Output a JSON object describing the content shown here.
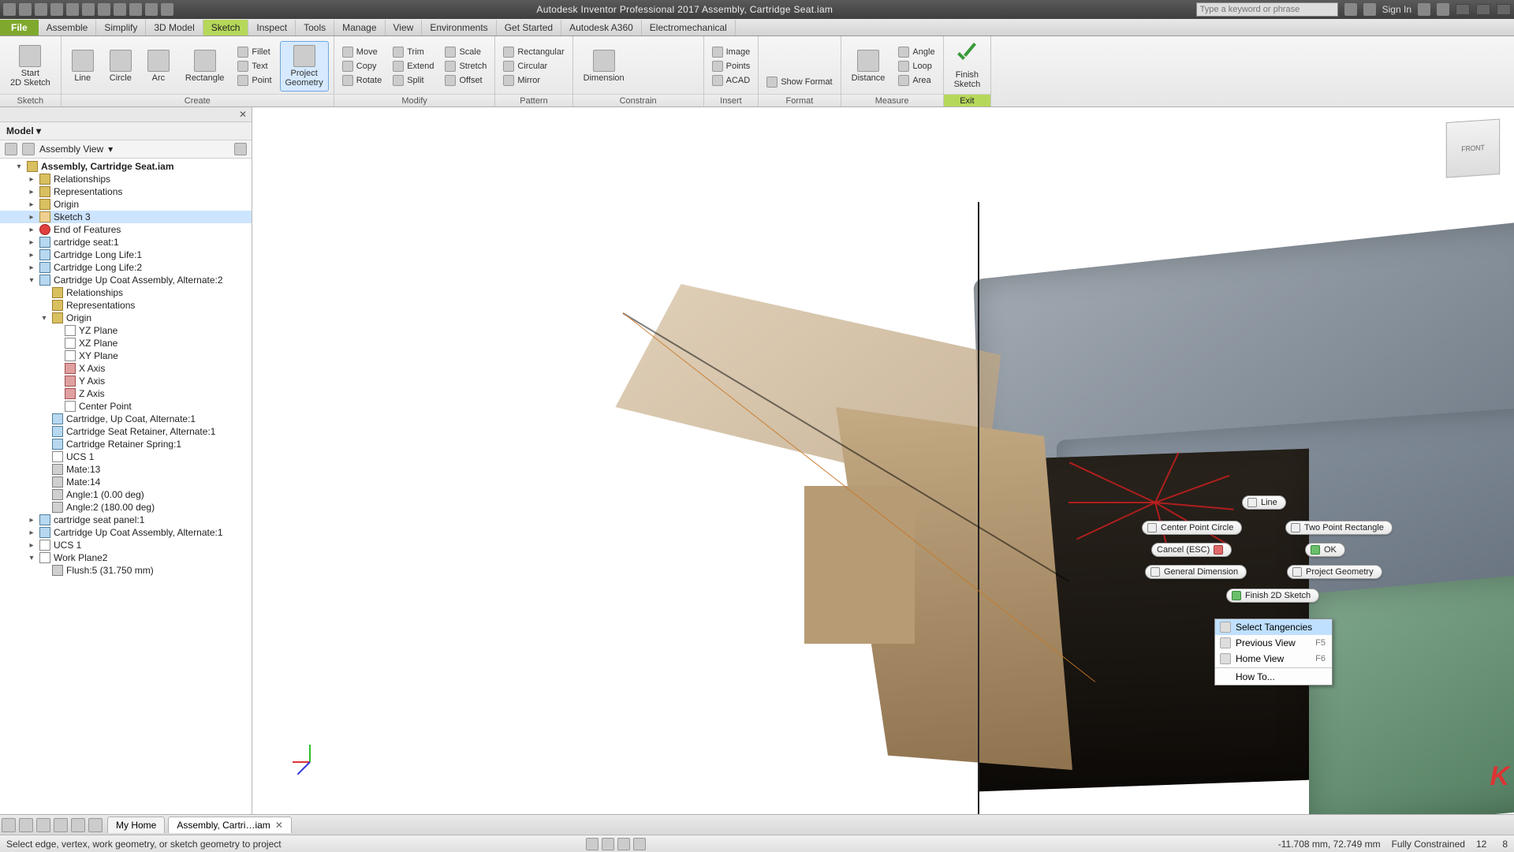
{
  "title": "Autodesk Inventor Professional 2017   Assembly, Cartridge Seat.iam",
  "search_placeholder": "Type a keyword or phrase",
  "sign_in": "Sign In",
  "tabs": {
    "file": "File",
    "items": [
      "Assemble",
      "Simplify",
      "3D Model",
      "Sketch",
      "Inspect",
      "Tools",
      "Manage",
      "View",
      "Environments",
      "Get Started",
      "Autodesk A360",
      "Electromechanical"
    ],
    "active": "Sketch"
  },
  "ribbon": {
    "sketch": {
      "big": "Start\n2D Sketch",
      "label": "Sketch"
    },
    "create": {
      "line": "Line",
      "circle": "Circle",
      "arc": "Arc",
      "rectangle": "Rectangle",
      "fillet": "Fillet",
      "text": "Text",
      "point": "Point",
      "project": "Project\nGeometry",
      "label": "Create"
    },
    "modify": {
      "move": "Move",
      "copy": "Copy",
      "rotate": "Rotate",
      "trim": "Trim",
      "extend": "Extend",
      "split": "Split",
      "scale": "Scale",
      "stretch": "Stretch",
      "offset": "Offset",
      "label": "Modify"
    },
    "pattern": {
      "rect": "Rectangular",
      "circ": "Circular",
      "mirror": "Mirror",
      "label": "Pattern"
    },
    "constrain": {
      "dim": "Dimension",
      "label": "Constrain"
    },
    "insert": {
      "image": "Image",
      "points": "Points",
      "acad": "ACAD",
      "label": "Insert"
    },
    "format": {
      "show": "Show Format",
      "label": "Format"
    },
    "measure": {
      "dist": "Distance",
      "angle": "Angle",
      "loop": "Loop",
      "area": "Area",
      "label": "Measure"
    },
    "exit": {
      "finish": "Finish\nSketch",
      "label": "Exit"
    }
  },
  "browser": {
    "title": "Model",
    "filter": "Assembly View",
    "root": "Assembly, Cartridge Seat.iam",
    "nodes": [
      {
        "d": 1,
        "t": "Relationships",
        "ico": "fold"
      },
      {
        "d": 1,
        "t": "Representations",
        "ico": "fold"
      },
      {
        "d": 1,
        "t": "Origin",
        "ico": "fold"
      },
      {
        "d": 1,
        "t": "Sketch 3",
        "ico": "sketch",
        "sel": true
      },
      {
        "d": 1,
        "t": "End of Features",
        "ico": "err"
      },
      {
        "d": 1,
        "t": "cartridge seat:1",
        "ico": "part"
      },
      {
        "d": 1,
        "t": "Cartridge Long Life:1",
        "ico": "part"
      },
      {
        "d": 1,
        "t": "Cartridge Long Life:2",
        "ico": "part"
      },
      {
        "d": 1,
        "t": "Cartridge Up Coat Assembly, Alternate:2",
        "ico": "part",
        "exp": true
      },
      {
        "d": 2,
        "t": "Relationships",
        "ico": "fold"
      },
      {
        "d": 2,
        "t": "Representations",
        "ico": "fold"
      },
      {
        "d": 2,
        "t": "Origin",
        "ico": "fold",
        "exp": true
      },
      {
        "d": 3,
        "t": "YZ Plane",
        "ico": "plane"
      },
      {
        "d": 3,
        "t": "XZ Plane",
        "ico": "plane"
      },
      {
        "d": 3,
        "t": "XY Plane",
        "ico": "plane"
      },
      {
        "d": 3,
        "t": "X Axis",
        "ico": "axis"
      },
      {
        "d": 3,
        "t": "Y Axis",
        "ico": "axis"
      },
      {
        "d": 3,
        "t": "Z Axis",
        "ico": "axis"
      },
      {
        "d": 3,
        "t": "Center Point",
        "ico": "plane"
      },
      {
        "d": 2,
        "t": "Cartridge, Up Coat, Alternate:1",
        "ico": "part"
      },
      {
        "d": 2,
        "t": "Cartridge Seat Retainer, Alternate:1",
        "ico": "part"
      },
      {
        "d": 2,
        "t": "Cartridge Retainer Spring:1",
        "ico": "part"
      },
      {
        "d": 2,
        "t": "UCS 1",
        "ico": "plane"
      },
      {
        "d": 2,
        "t": "Mate:13",
        "ico": "mate"
      },
      {
        "d": 2,
        "t": "Mate:14",
        "ico": "mate"
      },
      {
        "d": 2,
        "t": "Angle:1 (0.00 deg)",
        "ico": "mate"
      },
      {
        "d": 2,
        "t": "Angle:2 (180.00 deg)",
        "ico": "mate"
      },
      {
        "d": 1,
        "t": "cartridge seat panel:1",
        "ico": "part"
      },
      {
        "d": 1,
        "t": "Cartridge Up Coat Assembly, Alternate:1",
        "ico": "part"
      },
      {
        "d": 1,
        "t": "UCS 1",
        "ico": "plane"
      },
      {
        "d": 1,
        "t": "Work Plane2",
        "ico": "plane",
        "exp": true
      },
      {
        "d": 2,
        "t": "Flush:5 (31.750 mm)",
        "ico": "mate"
      }
    ]
  },
  "marking": {
    "line": "Line",
    "two_pt_rect": "Two Point Rectangle",
    "center_circle": "Center Point Circle",
    "cancel": "Cancel (ESC)",
    "ok": "OK",
    "gen_dim": "General Dimension",
    "proj_geom": "Project Geometry",
    "finish": "Finish 2D Sketch"
  },
  "ctx": {
    "select_tan": "Select Tangencies",
    "prev_view": "Previous View",
    "prev_sc": "F5",
    "home_view": "Home View",
    "home_sc": "F6",
    "how_to": "How To..."
  },
  "doctabs": {
    "home": "My Home",
    "doc": "Assembly, Cartri…iam"
  },
  "status": {
    "prompt": "Select edge, vertex, work geometry, or sketch geometry to project",
    "coords": "-11.708 mm, 72.749 mm",
    "constrain": "Fully Constrained",
    "dims": "12",
    "count": "8"
  },
  "viewcube": "FRONT"
}
